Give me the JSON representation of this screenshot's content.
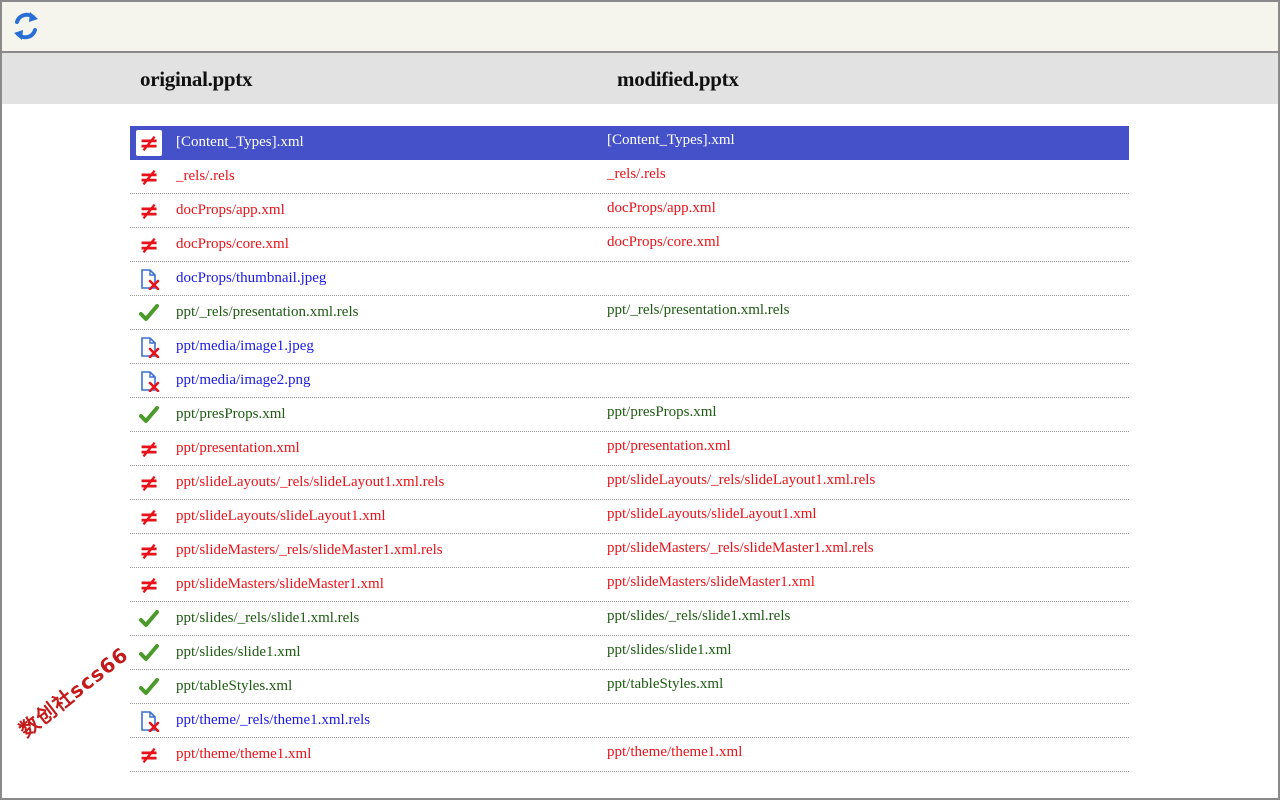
{
  "toolbar": {
    "refresh_icon": "refresh-icon"
  },
  "header": {
    "left_title": "original.pptx",
    "right_title": "modified.pptx"
  },
  "colors": {
    "selected_row": "#4451c8",
    "diff": "#e8131a",
    "same": "#1d5b12",
    "removed": "#1a1ae6"
  },
  "files": [
    {
      "status": "different",
      "left": "[Content_Types].xml",
      "right": "[Content_Types].xml",
      "selected": true
    },
    {
      "status": "different",
      "left": "_rels/.rels",
      "right": "_rels/.rels"
    },
    {
      "status": "different",
      "left": "docProps/app.xml",
      "right": "docProps/app.xml"
    },
    {
      "status": "different",
      "left": "docProps/core.xml",
      "right": "docProps/core.xml"
    },
    {
      "status": "removed",
      "left": "docProps/thumbnail.jpeg",
      "right": ""
    },
    {
      "status": "same",
      "left": "ppt/_rels/presentation.xml.rels",
      "right": "ppt/_rels/presentation.xml.rels"
    },
    {
      "status": "removed",
      "left": "ppt/media/image1.jpeg",
      "right": ""
    },
    {
      "status": "removed",
      "left": "ppt/media/image2.png",
      "right": ""
    },
    {
      "status": "same",
      "left": "ppt/presProps.xml",
      "right": "ppt/presProps.xml"
    },
    {
      "status": "different",
      "left": "ppt/presentation.xml",
      "right": "ppt/presentation.xml"
    },
    {
      "status": "different",
      "left": "ppt/slideLayouts/_rels/slideLayout1.xml.rels",
      "right": "ppt/slideLayouts/_rels/slideLayout1.xml.rels"
    },
    {
      "status": "different",
      "left": "ppt/slideLayouts/slideLayout1.xml",
      "right": "ppt/slideLayouts/slideLayout1.xml"
    },
    {
      "status": "different",
      "left": "ppt/slideMasters/_rels/slideMaster1.xml.rels",
      "right": "ppt/slideMasters/_rels/slideMaster1.xml.rels"
    },
    {
      "status": "different",
      "left": "ppt/slideMasters/slideMaster1.xml",
      "right": "ppt/slideMasters/slideMaster1.xml"
    },
    {
      "status": "same",
      "left": "ppt/slides/_rels/slide1.xml.rels",
      "right": "ppt/slides/_rels/slide1.xml.rels"
    },
    {
      "status": "same",
      "left": "ppt/slides/slide1.xml",
      "right": "ppt/slides/slide1.xml"
    },
    {
      "status": "same",
      "left": "ppt/tableStyles.xml",
      "right": "ppt/tableStyles.xml"
    },
    {
      "status": "removed",
      "left": "ppt/theme/_rels/theme1.xml.rels",
      "right": ""
    },
    {
      "status": "different",
      "left": "ppt/theme/theme1.xml",
      "right": "ppt/theme/theme1.xml"
    }
  ],
  "watermark": "数创社scs66"
}
